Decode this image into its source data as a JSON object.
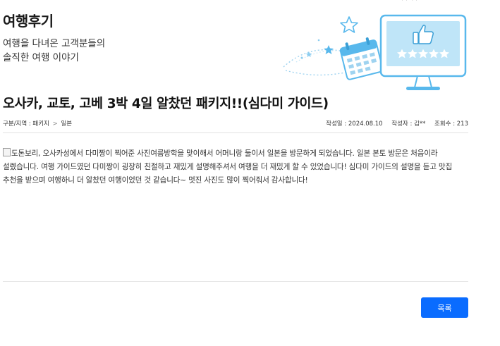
{
  "header": {
    "title": "여행후기",
    "desc_line1": "여행을 다녀온 고객분들의",
    "desc_line2": "솔직한 여행 이야기",
    "top_crop_text": "(   )  (   )"
  },
  "post": {
    "title": "오사카, 교토, 고베 3박 4일 알찼던 패키지!!(심다미 가이드)",
    "breadcrumb": {
      "lead": "구분/지역 : 패키지",
      "separator": ">",
      "region": "일본"
    },
    "date": "작성일 : 2024.08.10",
    "author": "작성자 : 김**",
    "views": "조회수 : 213",
    "image_alt": "도톤보리, 오사카성에서 다미짱이 찍어준 사진",
    "body": "여름방학을 맞이해서 어머니랑 둘이서 일본을 방문하게 되었습니다. 일본 본토 방문은 처음이라 설렜습니다. 여행 가이드였던 다미짱이 굉장히 친절하고 재밌게 설명해주셔서 여행을 더 재밌게 할 수 있었습니다! 심다미 가이드의 설명을 듣고 맛집 추천을 받으며 여행하니 더 알찼던 여행이었던 것 같습니다~ 멋진 사진도 많이 찍어줘서 감사합니다!"
  },
  "buttons": {
    "list_label": "목록"
  },
  "colors": {
    "accent": "#0a6cff",
    "illustration_blue": "#58b8ec",
    "illustration_light": "#d8effb"
  },
  "icons": {
    "hero": "review-monitor-illustration",
    "calendar": "calendar-icon",
    "star": "star-icon",
    "thumbs_up": "thumbs-up-icon",
    "broken_image": "broken-image-icon"
  }
}
